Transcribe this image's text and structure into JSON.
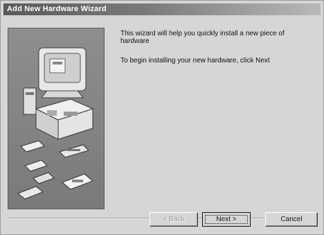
{
  "window": {
    "title": "Add New Hardware Wizard"
  },
  "body": {
    "line1": "This wizard will help you quickly install a new piece of hardware",
    "line2": "To begin installing your new hardware, click Next"
  },
  "buttons": {
    "back": "< Back",
    "next": "Next >",
    "cancel": "Cancel"
  },
  "icons": {
    "wizard_picture": "computer-hardware-illustration"
  }
}
